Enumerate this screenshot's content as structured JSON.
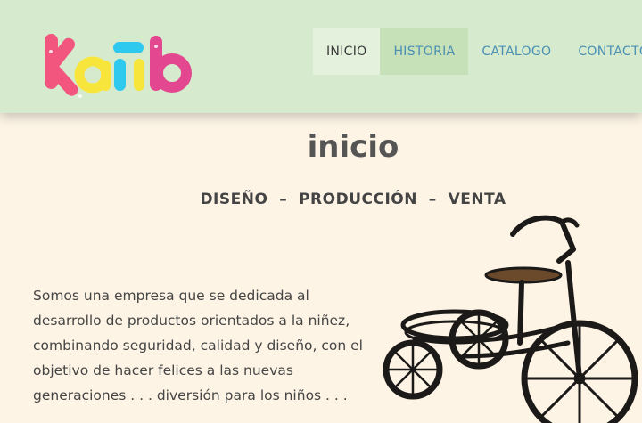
{
  "header": {
    "logo_text": "kaiib",
    "nav": [
      {
        "label": "INICIO",
        "state": "active"
      },
      {
        "label": "HISTORIA",
        "state": "hover"
      },
      {
        "label": "CATALOGO",
        "state": "normal"
      },
      {
        "label": "CONTACTO",
        "state": "normal"
      }
    ]
  },
  "main": {
    "title": "inicio",
    "tagline": "DISEÑO  –  PRODUCCIÓN  –  VENTA",
    "intro": "Somos una empresa que se dedicada al\ndesarrollo de productos orientados a la niñez,\ncombinando seguridad, calidad y diseño, con el\nobjetivo de hacer felices a las nuevas\ngeneraciones . . .   diversión para los niños . . .",
    "image_subject": "tricycle-planter"
  },
  "colors": {
    "header_bg": "#d6ebcd",
    "page_bg": "#fdf4e5",
    "nav_link": "#4a90b5",
    "nav_active_bg": "#e4f1dc",
    "nav_hover_bg": "#c6e0b8",
    "logo_pink": "#f2567f",
    "logo_yellow": "#f7e53c",
    "logo_cyan": "#2fc8ee",
    "logo_magenta": "#e2478f"
  }
}
